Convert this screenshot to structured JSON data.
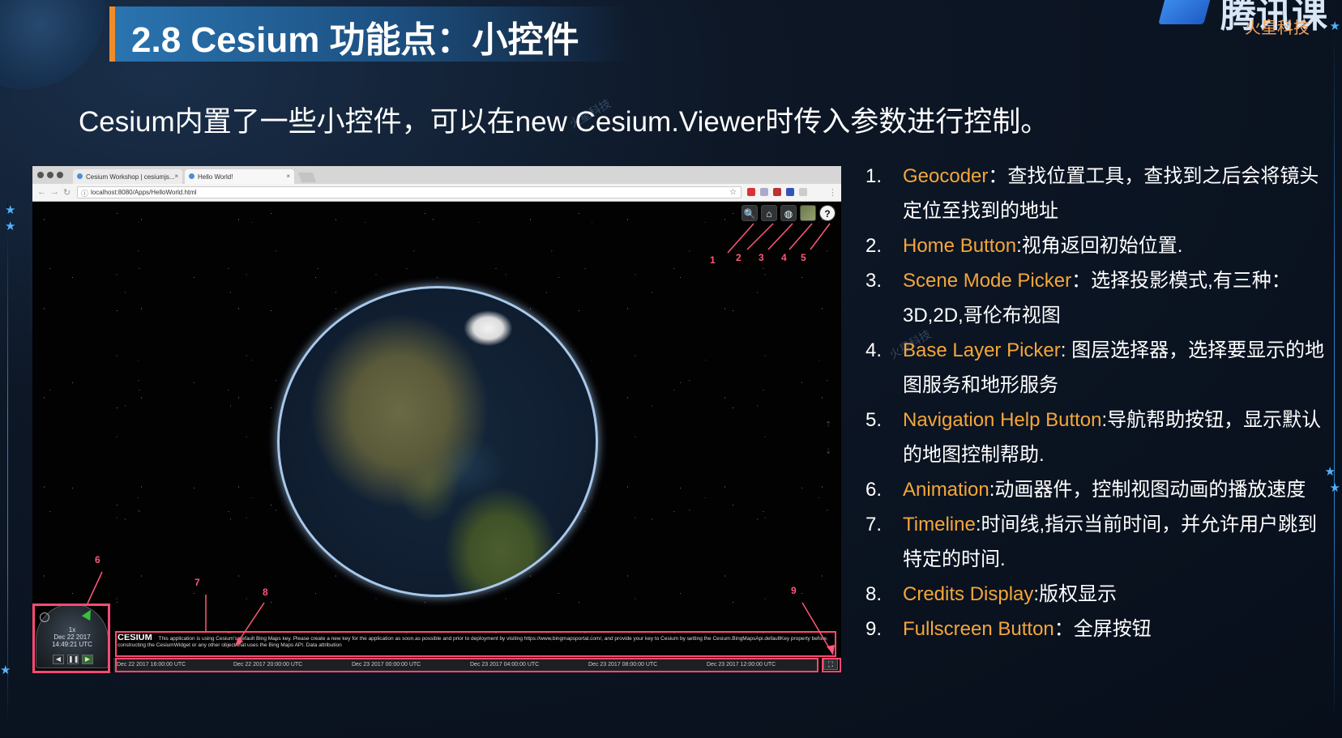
{
  "slide": {
    "title": "2.8 Cesium 功能点：小控件",
    "subtitle": "Cesium内置了一些小控件，可以在new Cesium.Viewer时传入参数进行控制。",
    "logo": {
      "main": "腾讯课",
      "sub": "火星科技"
    },
    "watermark": "火星科技",
    "accent_color": "#f08c2a",
    "highlight_color": "#f4a63a"
  },
  "browser": {
    "tabs": [
      {
        "label": "Cesium Workshop | cesiumjs..."
      },
      {
        "label": "Hello World!"
      }
    ],
    "url": "localhost:8080/Apps/HelloWorld.html",
    "nav_icons": [
      "back-icon",
      "forward-icon",
      "reload-icon"
    ]
  },
  "viewer": {
    "toolbar": [
      {
        "icon": "search-icon",
        "glyph": "🔍"
      },
      {
        "icon": "home-icon",
        "glyph": "⌂"
      },
      {
        "icon": "globe-icon",
        "glyph": "◍"
      },
      {
        "icon": "layers-icon",
        "glyph": ""
      },
      {
        "icon": "help-icon",
        "glyph": "?"
      }
    ],
    "animation": {
      "speed": "1x",
      "date": "Dec 22 2017",
      "time": "14:49:21 UTC"
    },
    "credits_logo": "CESIUM",
    "credits_text": "This application is using Cesium's default Bing Maps key. Please create a new key for the application as soon as possible and prior to deployment by visiting https://www.bingmapsportal.com/, and provide your key to Cesium by setting the Cesium.BingMapsApi.defaultKey property before constructing the CesiumWidget or any other object that uses the Bing Maps API. Data attribution",
    "timeline_ticks": [
      "Dec 22 2017 16:00:00 UTC",
      "Dec 22 2017 20:00:00 UTC",
      "Dec 23 2017 00:00:00 UTC",
      "Dec 23 2017 04:00:00 UTC",
      "Dec 23 2017 08:00:00 UTC",
      "Dec 23 2017 12:00:00 UTC"
    ]
  },
  "annotations": [
    "1",
    "2",
    "3",
    "4",
    "5",
    "6",
    "7",
    "8",
    "9"
  ],
  "features": [
    {
      "num": "1.",
      "name": "Geocoder",
      "desc": "：查找位置工具，查找到之后会将镜头定位至找到的地址"
    },
    {
      "num": "2.",
      "name": "Home Button",
      "desc": ":视角返回初始位置."
    },
    {
      "num": "3.",
      "name": "Scene Mode Picker",
      "desc": "：选择投影模式,有三种：3D,2D,哥伦布视图"
    },
    {
      "num": "4.",
      "name": "Base Layer Picker",
      "desc": ": 图层选择器，选择要显示的地图服务和地形服务"
    },
    {
      "num": "5.",
      "name": "Navigation Help Button",
      "desc": ":导航帮助按钮，显示默认的地图控制帮助."
    },
    {
      "num": "6.",
      "name": "Animation",
      "desc": ":动画器件，控制视图动画的播放速度"
    },
    {
      "num": "7.",
      "name": "Timeline",
      "desc": ":时间线,指示当前时间，并允许用户跳到特定的时间."
    },
    {
      "num": "8.",
      "name": "Credits Display",
      "desc": ":版权显示"
    },
    {
      "num": "9.",
      "name": "Fullscreen Button",
      "desc": "：全屏按钮"
    }
  ]
}
